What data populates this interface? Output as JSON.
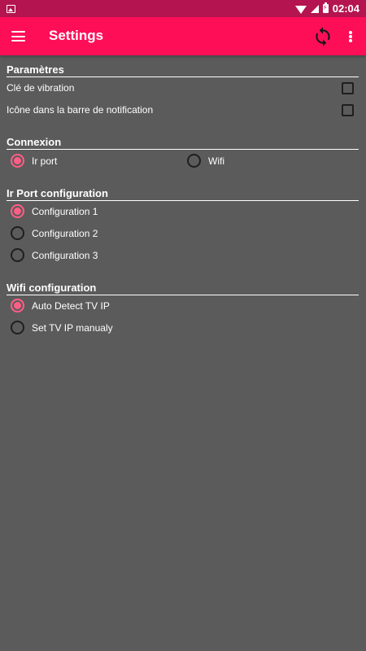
{
  "status_bar": {
    "time": "02:04",
    "icons": [
      "gallery-icon",
      "wifi-icon",
      "signal-icon",
      "battery-charging-icon"
    ]
  },
  "app_bar": {
    "title": "Settings",
    "icons": [
      "menu-icon",
      "refresh-icon",
      "more-vert-icon"
    ]
  },
  "colors": {
    "status_bar": "#b4144f",
    "app_bar": "#ff0e58",
    "background": "#5b5b5b",
    "accent": "#ff5f86"
  },
  "sections": {
    "parametres": {
      "title": "Paramètres",
      "options": [
        {
          "label": "Clé de vibration",
          "checked": false
        },
        {
          "label": "Icône dans la barre de notification",
          "checked": false
        }
      ]
    },
    "connexion": {
      "title": "Connexion",
      "options": [
        {
          "label": "Ir port",
          "selected": true
        },
        {
          "label": "Wifi",
          "selected": false
        }
      ]
    },
    "ir_port": {
      "title": "Ir Port configuration",
      "options": [
        {
          "label": "Configuration 1",
          "selected": true
        },
        {
          "label": "Configuration 2",
          "selected": false
        },
        {
          "label": "Configuration 3",
          "selected": false
        }
      ]
    },
    "wifi": {
      "title": "Wifi configuration",
      "options": [
        {
          "label": "Auto Detect TV IP",
          "selected": true
        },
        {
          "label": "Set TV IP manualy",
          "selected": false
        }
      ]
    }
  }
}
